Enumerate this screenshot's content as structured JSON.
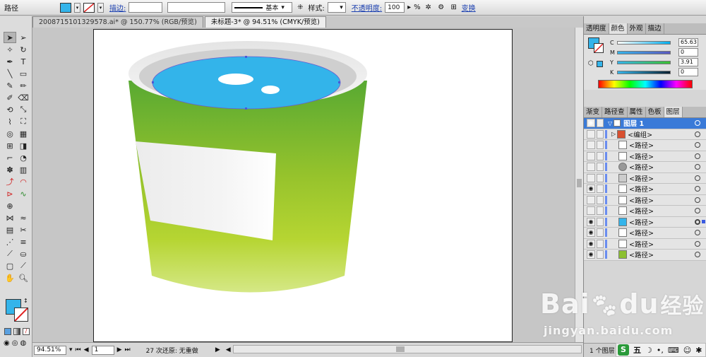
{
  "control_bar": {
    "object_type": "路径",
    "fill_color": "#34b4ea",
    "stroke_label": "描边:",
    "stroke_width_value": "",
    "basic_label": "基本",
    "style_label": "样式:",
    "opacity_label": "不透明度:",
    "opacity_value": "100",
    "percent": "%",
    "transform_label": "变换"
  },
  "doc_tabs": [
    {
      "label": "2008715101329578.ai* @ 150.77% (RGB/预览)"
    },
    {
      "label": "未标题-3* @ 94.51% (CMYK/预览)"
    }
  ],
  "status": {
    "zoom": "94.51%",
    "artboard": "1",
    "info": "27 次还原: 无重做"
  },
  "color_panel": {
    "tabs": [
      "透明度",
      "颜色",
      "外观",
      "描边"
    ],
    "rows": [
      {
        "label": "C",
        "value": "65.63"
      },
      {
        "label": "M",
        "value": "0"
      },
      {
        "label": "Y",
        "value": "3.91"
      },
      {
        "label": "K",
        "value": "0"
      }
    ],
    "fill": "#34b4ea"
  },
  "layers_panel": {
    "tabs": [
      "渐变",
      "路径查",
      "属性",
      "色板",
      "图层"
    ],
    "layer_name": "图层 1",
    "items": [
      "<编组>",
      "<路径>",
      "<路径>",
      "<路径>",
      "<路径>",
      "<路径>",
      "<路径>",
      "<路径>",
      "<路径>",
      "<路径>",
      "<路径>",
      "<路径>"
    ],
    "footer": "1 个图层"
  },
  "watermark": {
    "brand": "Bai",
    "brand2": "du",
    "brand3": "经验",
    "url": "jingyan.baidu.com"
  },
  "ime": {
    "s": "S",
    "wu": "五"
  }
}
